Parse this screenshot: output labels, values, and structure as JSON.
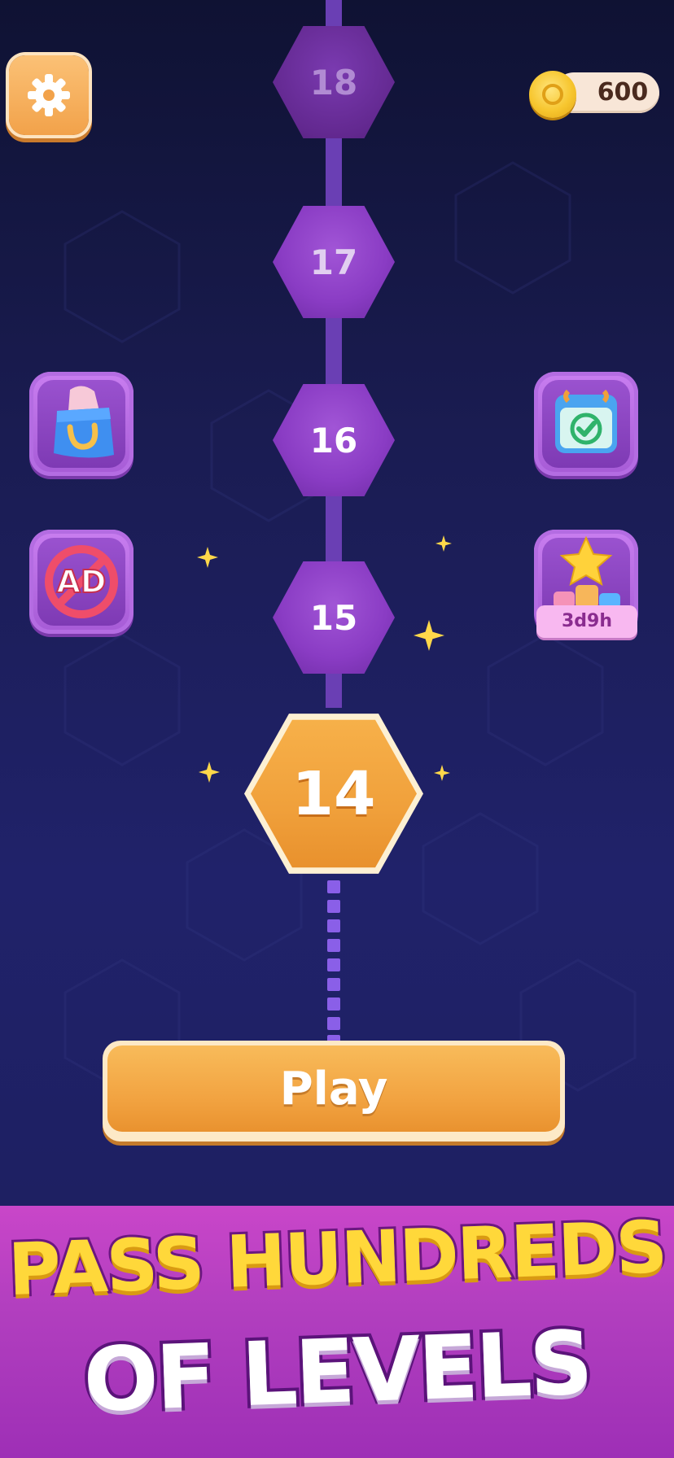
{
  "header": {
    "settings_icon": "gear-icon",
    "coins": "600",
    "coin_icon": "coin-icon"
  },
  "levels": {
    "locked": [
      "18",
      "17",
      "16",
      "15"
    ],
    "current": "14"
  },
  "side_buttons": {
    "left": [
      {
        "name": "shop",
        "icon": "shopping-bag-icon"
      },
      {
        "name": "remove-ads",
        "icon": "no-ads-icon",
        "label": "AD"
      }
    ],
    "right": [
      {
        "name": "daily-challenge",
        "icon": "calendar-check-icon"
      },
      {
        "name": "leaderboard-event",
        "icon": "star-podium-icon",
        "timer": "3d9h"
      }
    ]
  },
  "play_button": {
    "label": "Play"
  },
  "banner": {
    "line1": "PASS HUNDREDS",
    "line2": "OF LEVELS"
  },
  "colors": {
    "background": "#1a1c52",
    "node_locked": "#8a3cc4",
    "node_current": "#f0a03b",
    "play": "#f2a442",
    "banner": "#b23fbf",
    "banner_text_yellow": "#ffd83a"
  }
}
